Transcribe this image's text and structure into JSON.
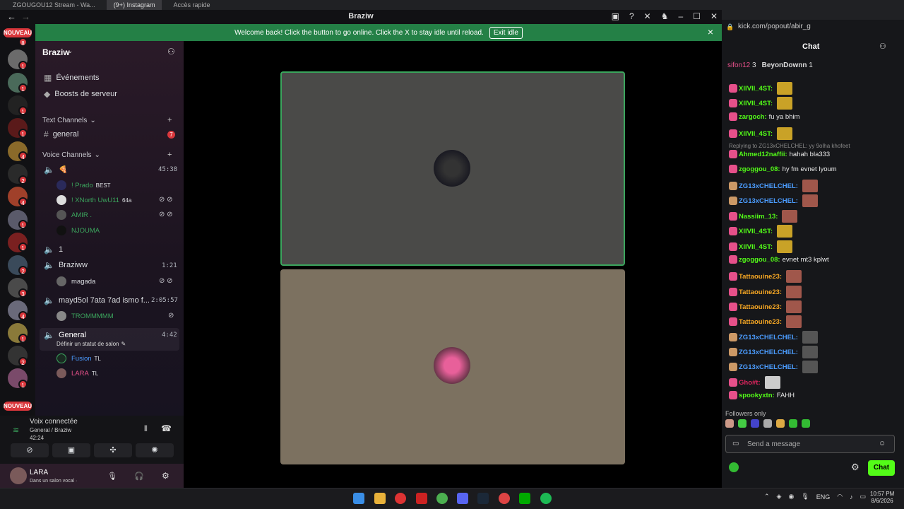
{
  "browser": {
    "tabs": [
      "ZGOUGOU12 Stream - Wa...",
      "(9+) Instagram",
      "Accès rapide"
    ]
  },
  "window": {
    "title": "Braziw"
  },
  "banner": {
    "text": "Welcome back! Click the button to go online. Click the X to stay idle until reload.",
    "button": "Exit idle"
  },
  "rail": {
    "nouveau_top": "NOUVEAU",
    "nouveau_bottom": "NOUVEAU",
    "badges": [
      "8",
      "1",
      "1",
      "1",
      "1",
      "4",
      "2",
      "4",
      "1",
      "1",
      "2",
      "3",
      "4",
      "1",
      "2",
      "1"
    ]
  },
  "guild": {
    "name": "Braziw",
    "events": "Événements",
    "boosts": "Boosts de serveur"
  },
  "text_channels": {
    "category": "Text Channels",
    "channels": [
      {
        "name": "general",
        "mentions": "7"
      }
    ]
  },
  "voice_channels": {
    "category": "Voice Channels",
    "channels": [
      {
        "name": "",
        "time": "45:38",
        "users": [
          {
            "name": "! Prado",
            "tag": "BEST"
          },
          {
            "name": "! XNorth UwU11",
            "tag": "64a"
          },
          {
            "name": "AMIR ."
          },
          {
            "name": "NJOUMA"
          }
        ]
      },
      {
        "name": "1",
        "time": "",
        "users": []
      },
      {
        "name": "Braziww",
        "time": "1:21",
        "users": [
          {
            "name": "magada"
          }
        ]
      },
      {
        "name": "mayd5ol 7ata 7ad ismo f...",
        "time": "2:05:57",
        "users": [
          {
            "name": "TROMMMMM"
          }
        ]
      },
      {
        "name": "General",
        "time": "4:42",
        "status": "Définir un statut de salon",
        "users": [
          {
            "name": "Fusion",
            "tag": "TL"
          },
          {
            "name": "LARA",
            "tag": "TL"
          }
        ]
      }
    ]
  },
  "voice_panel": {
    "status": "Voix connectée",
    "location": "General / Braziw",
    "elapsed": "42:24"
  },
  "user_panel": {
    "name": "LARA",
    "status": "Dans un salon vocal ·"
  },
  "chat": {
    "url": "kick.com/popout/abir_g",
    "title": "Chat",
    "top_users": [
      {
        "name": "sifon12",
        "count": "3"
      },
      {
        "name": "BeyonDownn",
        "count": "1"
      }
    ],
    "reply_note": "Replying to ZG13xCHELCHEL: yy 9olha khofeet",
    "messages": [
      {
        "user": "XIIVII_4ST:",
        "text": "",
        "color": "#53fc18",
        "emote": "#c9a227"
      },
      {
        "user": "XIIVII_4ST:",
        "text": "",
        "color": "#53fc18",
        "emote": "#c9a227"
      },
      {
        "user": "zargoch:",
        "text": "fu ya bhim",
        "color": "#53fc18",
        "emote": ""
      },
      {
        "user": "XIIVII_4ST:",
        "text": "",
        "color": "#53fc18",
        "emote": "#c9a227"
      },
      {
        "user": "Ahmed12naffii:",
        "text": "hahah bla333",
        "color": "#53fc18",
        "emote": ""
      },
      {
        "user": "zgoggou_08:",
        "text": "hy fm evnet lyoum",
        "color": "#53fc18",
        "emote": ""
      },
      {
        "user": "ZG13xCHELCHEL:",
        "text": "",
        "color": "#4b9cff",
        "emote": "#a0574b"
      },
      {
        "user": "ZG13xCHELCHEL:",
        "text": "",
        "color": "#4b9cff",
        "emote": "#a0574b"
      },
      {
        "user": "Nassiim_13:",
        "text": "",
        "color": "#53fc18",
        "emote": "#a0574b"
      },
      {
        "user": "XIIVII_4ST:",
        "text": "",
        "color": "#53fc18",
        "emote": "#c9a227"
      },
      {
        "user": "XIIVII_4ST:",
        "text": "",
        "color": "#53fc18",
        "emote": "#c9a227"
      },
      {
        "user": "zgoggou_08:",
        "text": "evnet mt3 kplwt",
        "color": "#53fc18",
        "emote": ""
      },
      {
        "user": "Tattaouine23:",
        "text": "",
        "color": "#f5a623",
        "emote": "#a0574b"
      },
      {
        "user": "Tattaouine23:",
        "text": "",
        "color": "#f5a623",
        "emote": "#a0574b"
      },
      {
        "user": "Tattaouine23:",
        "text": "",
        "color": "#f5a623",
        "emote": "#a0574b"
      },
      {
        "user": "Tattaouine23:",
        "text": "",
        "color": "#f5a623",
        "emote": "#a0574b"
      },
      {
        "user": "ZG13xCHELCHEL:",
        "text": "",
        "color": "#4b9cff",
        "emote": "#555"
      },
      {
        "user": "ZG13xCHELCHEL:",
        "text": "",
        "color": "#4b9cff",
        "emote": "#555"
      },
      {
        "user": "ZG13xCHELCHEL:",
        "text": "",
        "color": "#4b9cff",
        "emote": "#555"
      },
      {
        "user": "Gho#t:",
        "text": "",
        "color": "#e0245e",
        "emote": "#ccc"
      },
      {
        "user": "spookyxtn:",
        "text": "FAHH",
        "color": "#53fc18",
        "emote": ""
      }
    ],
    "followers_only": "Followers only",
    "placeholder": "Send a message",
    "send_button": "Chat"
  },
  "taskbar": {
    "lang": "ENG",
    "time": "10:57 PM",
    "date": "8/6/2026"
  }
}
